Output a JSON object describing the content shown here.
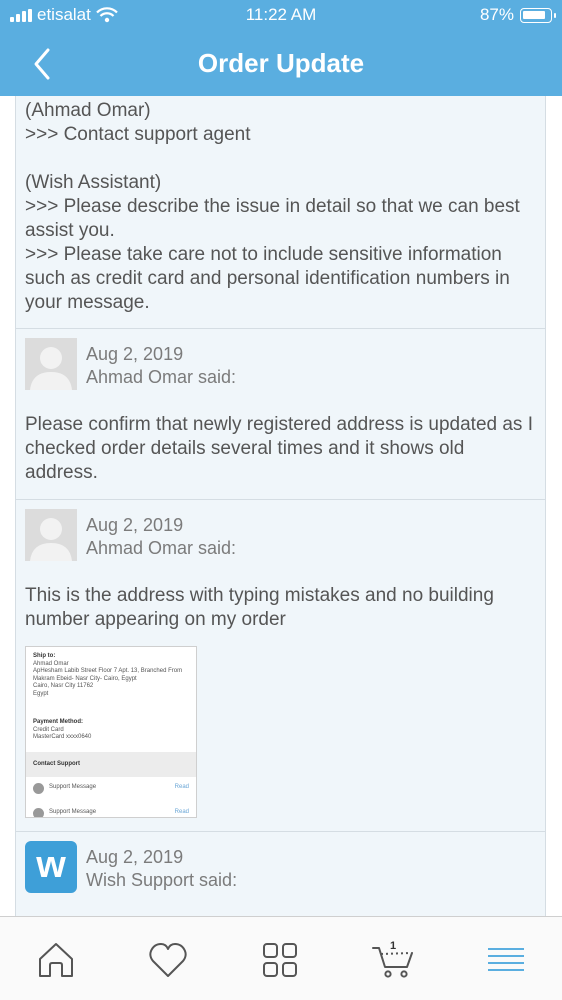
{
  "status_bar": {
    "carrier": "etisalat",
    "time": "11:22 AM",
    "battery": "87%"
  },
  "header": {
    "title": "Order Update"
  },
  "messages": [
    {
      "lines": [
        "(Ahmad Omar)",
        ">>> Contact support agent",
        "",
        "(Wish Assistant)",
        ">>> Please describe the issue in detail so that we can best assist you.",
        ">>> Please take care not to include sensitive information such as credit card and personal identification numbers in your message."
      ]
    },
    {
      "date": "Aug 2, 2019",
      "author": "Ahmad Omar said:",
      "body": "Please confirm that newly registered address is updated as I checked order details several times and it shows old address."
    },
    {
      "date": "Aug 2, 2019",
      "author": "Ahmad Omar said:",
      "body": "This is the address with typing mistakes and no building number appearing on my order",
      "attachment": {
        "ship_to_label": "Ship to:",
        "ship_name": "Ahmad Omar",
        "ship_line1": "ApHesham Labib Street Floor 7 Apt. 13, Branched From",
        "ship_line2": "Makram Ebeid- Nasr City- Cairo, Egypt",
        "ship_line3": "Cairo, Nasr City 11762",
        "ship_line4": "Egypt",
        "payment_label": "Payment Method:",
        "payment_type": "Credit Card",
        "payment_card": "MasterCard xxxx0640",
        "support_label": "Contact Support",
        "support_msg1": "Support Message",
        "support_msg2": "Support Message",
        "read_label": "Read"
      }
    },
    {
      "date": "Aug 2, 2019",
      "author": "Wish Support said:",
      "logo_letter": "w"
    }
  ],
  "tabbar": {
    "cart_count": "1"
  },
  "colors": {
    "header_bg": "#5aaee0",
    "card_bg": "#f0f6fa",
    "tab_accent": "#5aaee0",
    "icon_gray": "#555555"
  }
}
